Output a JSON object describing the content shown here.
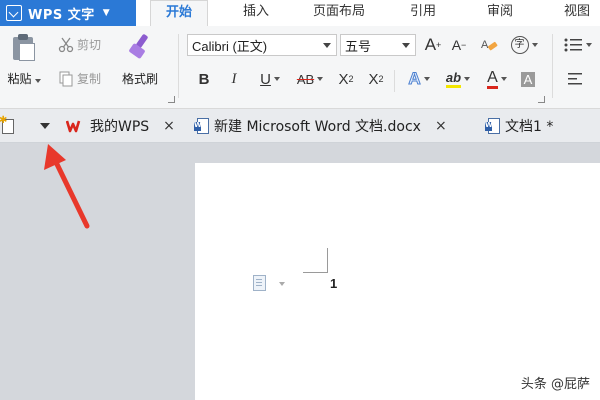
{
  "app": {
    "title": "WPS 文字"
  },
  "menu_tabs": [
    {
      "label": "开始",
      "active": true
    },
    {
      "label": "插入"
    },
    {
      "label": "页面布局"
    },
    {
      "label": "引用"
    },
    {
      "label": "审阅"
    },
    {
      "label": "视图"
    }
  ],
  "ribbon": {
    "clipboard": {
      "paste_label": "粘贴",
      "cut_label": "剪切",
      "copy_label": "复制",
      "format_painter_label": "格式刷"
    },
    "font": {
      "font_name": "Calibri (正文)",
      "font_size": "五号",
      "grow_label": "A",
      "shrink_label": "A",
      "bold": "B",
      "italic": "I",
      "underline": "U",
      "strikethrough": "AB",
      "superscript": "X",
      "superscript_mark": "2",
      "subscript": "X",
      "subscript_mark": "2",
      "effects": "A",
      "highlight": "ab",
      "font_color": "A",
      "shading": "A",
      "phonetic": "字"
    }
  },
  "doc_tabs": [
    {
      "label": "我的WPS",
      "close": "×"
    },
    {
      "label": "新建 Microsoft Word 文档.docx",
      "close": "×"
    },
    {
      "label": "文档1 *"
    }
  ],
  "document": {
    "page_number": "1"
  },
  "watermark": "头条 @屁萨",
  "colors": {
    "accent": "#2b79d6",
    "annotation_arrow": "#e8382b",
    "wps_red": "#d9261c",
    "workspace": "#d4d7dc"
  }
}
